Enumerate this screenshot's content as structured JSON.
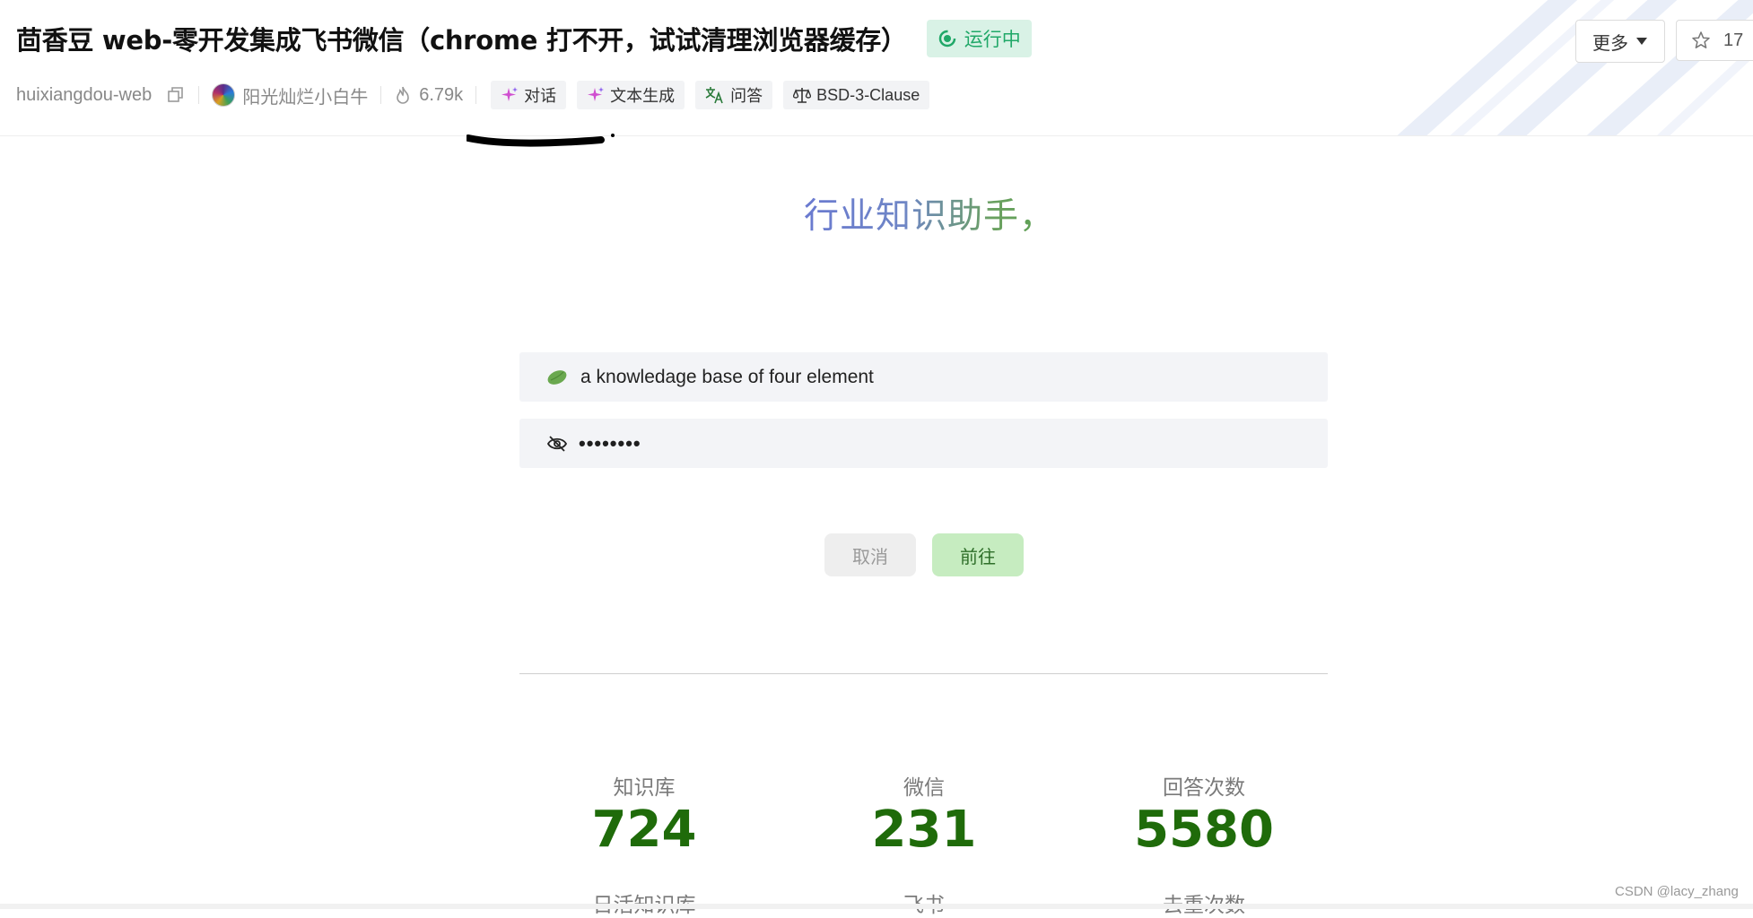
{
  "header": {
    "title": "茴香豆 web-零开发集成飞书微信（chrome 打不开，试试清理浏览器缓存）",
    "status": "运行中",
    "repo": "huixiangdou-web",
    "author": "阳光灿烂小白牛",
    "views": "6.79k",
    "tags": [
      {
        "label": "对话",
        "icon": "sparkle-icon"
      },
      {
        "label": "文本生成",
        "icon": "sparkle-icon"
      },
      {
        "label": "问答",
        "icon": "translate-icon"
      },
      {
        "label": "BSD-3-Clause",
        "icon": "scale-icon"
      }
    ],
    "more_label": "更多",
    "star_count": "17"
  },
  "main": {
    "heading": "行业知识助手，",
    "kb_input_value": "a knowledage base of four element",
    "password_value": "••••••••",
    "cancel_label": "取消",
    "go_label": "前往"
  },
  "stats": [
    {
      "label": "知识库",
      "value": "724",
      "sub_label": "日活知识库"
    },
    {
      "label": "微信",
      "value": "231",
      "sub_label": "飞书"
    },
    {
      "label": "回答次数",
      "value": "5580",
      "sub_label": "去重次数"
    }
  ],
  "watermark": "CSDN @lacy_zhang",
  "colors": {
    "accent_green": "#1f6b0a",
    "status_green": "#20a868",
    "go_button_bg": "#c6ecc0"
  }
}
